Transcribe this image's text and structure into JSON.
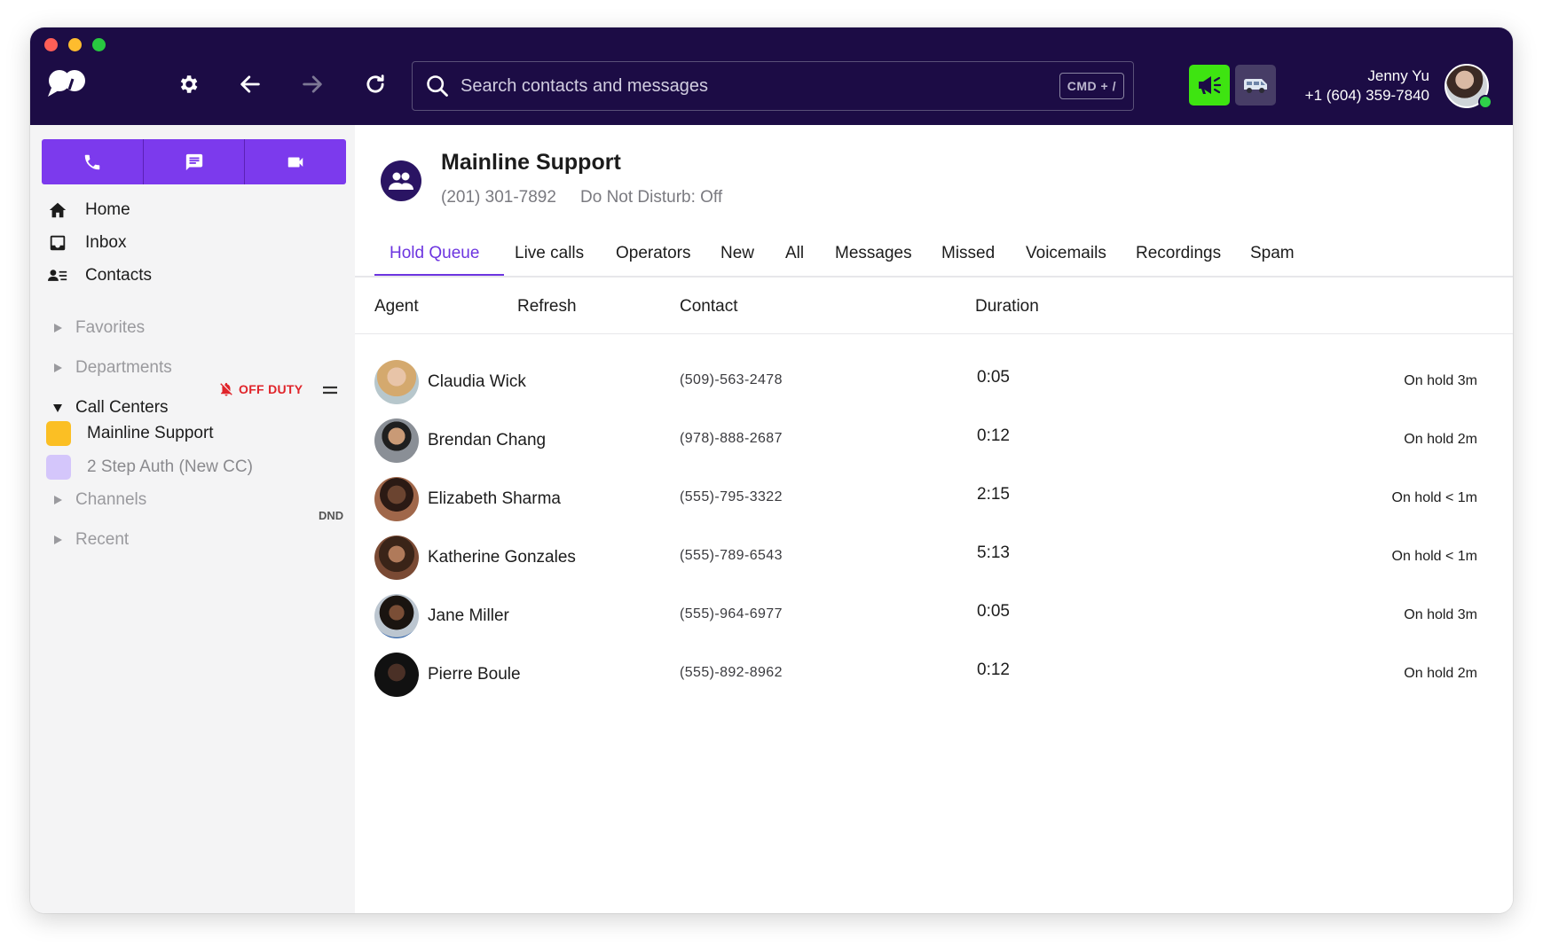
{
  "topbar": {
    "search_placeholder": "Search contacts and messages",
    "search_shortcut": "CMD + /",
    "user_name": "Jenny Yu",
    "user_phone": "+1 (604) 359-7840"
  },
  "sidebar": {
    "nav": [
      {
        "label": "Home",
        "icon": "home-icon"
      },
      {
        "label": "Inbox",
        "icon": "inbox-icon"
      },
      {
        "label": "Contacts",
        "icon": "contacts-icon"
      }
    ],
    "favorites": "Favorites",
    "departments": "Departments",
    "call_centers": "Call Centers",
    "off_duty": "OFF DUTY",
    "call_center_items": [
      {
        "label": "Mainline Support",
        "color": "#fbbf24"
      },
      {
        "label": "2 Step Auth (New CC)",
        "color": "#d4c6fb",
        "badge": "DND"
      }
    ],
    "channels": "Channels",
    "recent": "Recent"
  },
  "header": {
    "title": "Mainline Support",
    "phone": "(201) 301-7892",
    "dnd_status": "Do Not Disturb: Off"
  },
  "tabs": [
    "Hold Queue",
    "Live calls",
    "Operators",
    "New",
    "All",
    "Messages",
    "Missed",
    "Voicemails",
    "Recordings",
    "Spam"
  ],
  "active_tab": "Hold Queue",
  "table": {
    "headers": {
      "agent": "Agent",
      "refresh": "Refresh",
      "contact": "Contact",
      "duration": "Duration"
    },
    "rows": [
      {
        "name": "Claudia Wick",
        "contact": "(509)-563-2478",
        "duration": "0:05",
        "hold": "On hold 3m"
      },
      {
        "name": "Brendan Chang",
        "contact": "(978)-888-2687",
        "duration": "0:12",
        "hold": "On hold 2m"
      },
      {
        "name": "Elizabeth Sharma",
        "contact": "(555)-795-3322",
        "duration": "2:15",
        "hold": "On hold < 1m"
      },
      {
        "name": "Katherine Gonzales",
        "contact": "(555)-789-6543",
        "duration": "5:13",
        "hold": "On hold < 1m"
      },
      {
        "name": "Jane Miller",
        "contact": "(555)-964-6977",
        "duration": "0:05",
        "hold": "On hold 3m"
      },
      {
        "name": "Pierre Boule",
        "contact": "(555)-892-8962",
        "duration": "0:12",
        "hold": "On hold 2m"
      }
    ]
  },
  "colors": {
    "topbar": "#1c0c45",
    "accent": "#7c3aed",
    "active_tab": "#6d35e0",
    "off_duty": "#e0242a",
    "promo_green": "#3ee411"
  }
}
